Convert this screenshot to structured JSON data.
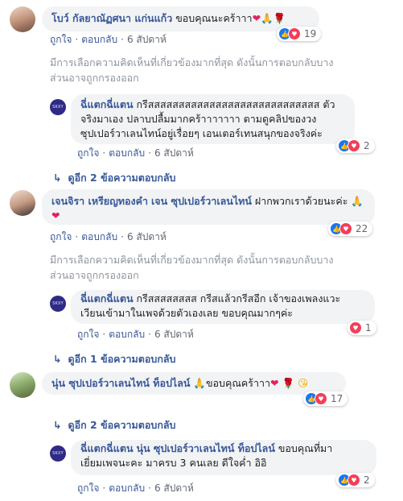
{
  "comments": [
    {
      "name": "โบว์ กัลยาณัฏศนา แก่นแก้ว",
      "text": "ขอบคุณนะคร้าาา",
      "emoji": [
        "❤",
        "🙏",
        "🌹"
      ],
      "actions": {
        "like": "ถูกใจ",
        "reply": "ตอบกลับ",
        "time": "6 สัปดาห์"
      },
      "reaction_count": "19"
    },
    {
      "name": "เจนจิรา เหรียญทองคำ",
      "tag": "เจน ซุปเปอร์วาเลนไทน์",
      "text": "ฝากพวกเราด้วยนะค่ะ",
      "emoji": [
        "🙏",
        "❤"
      ],
      "actions": {
        "like": "ถูกใจ",
        "reply": "ตอบกลับ",
        "time": "6 สัปดาห์"
      },
      "reaction_count": "22"
    },
    {
      "name": "นุ่น ซุปเปอร์วาเลนไทน์ ท็อปไลน์",
      "text": "ขอบคุณคร้าาา",
      "emoji_pre": "🙏",
      "emoji": [
        "❤",
        "🌹",
        "😘"
      ],
      "reaction_count": "17"
    }
  ],
  "replies": [
    {
      "name": "ฉี่แตกฉี่แตน",
      "text_l1": "กรีสสสสสสสสสสสสสสสสสสสสสสสสสสสส ตัว",
      "text_l2": "จริงมาเอง ปลาบปลื้มมากคร้าาาาาาา ตามดูคลิปของวง",
      "text_l3": "ซุปเปอร์วาเลนไทน์อยู่เรื่อยๆ เอนเตอร์เทนสนุกของจริงค่ะ",
      "actions": {
        "like": "ถูกใจ",
        "reply": "ตอบกลับ",
        "time": "6 สัปดาห์"
      },
      "reaction_count": "2"
    },
    {
      "name": "ฉี่แตกฉี่แตน",
      "text_l1": "กรีสสสสสสสส กรีสแล้วกรีสอีก เจ้าของเพลงแวะ",
      "text_l2": "เวียนเข้ามาในเพจด้วยตัวเองเลย ขอบคุณมากๆค่ะ",
      "actions": {
        "like": "ถูกใจ",
        "reply": "ตอบกลับ",
        "time": "6 สัปดาห์"
      },
      "reaction_count": "1"
    },
    {
      "name": "ฉี่แตกฉี่แตน",
      "tag": "นุ่น ซุปเปอร์วาเลนไทน์ ท็อปไลน์",
      "text_l1": "ขอบคุณที่มา",
      "text_l2": "เยี่ยมเพจนะคะ มาครบ 3 คนเลย ดีใจค่ำ อิอิ",
      "actions": {
        "like": "ถูกใจ",
        "reply": "ตอบกลับ",
        "time": "6 สัปดาห์"
      },
      "reaction_count": "2"
    }
  ],
  "filter_notice_l1": "มีการเลือกความคิดเห็นที่เกี่ยวข้องมากที่สุด ดังนั้นการตอบกลับบาง",
  "filter_notice_l2": "ส่วนอาจถูกกรองออก",
  "more_replies": {
    "two": "ดูอีก 2 ข้อความตอบกลับ",
    "one": "ดูอีก 1 ข้อความตอบกลับ"
  },
  "logo_text": "SKXY",
  "colors": {
    "link": "#385898",
    "bubble": "#f2f3f5",
    "like": "#1877f2",
    "love": "#f33e58"
  }
}
